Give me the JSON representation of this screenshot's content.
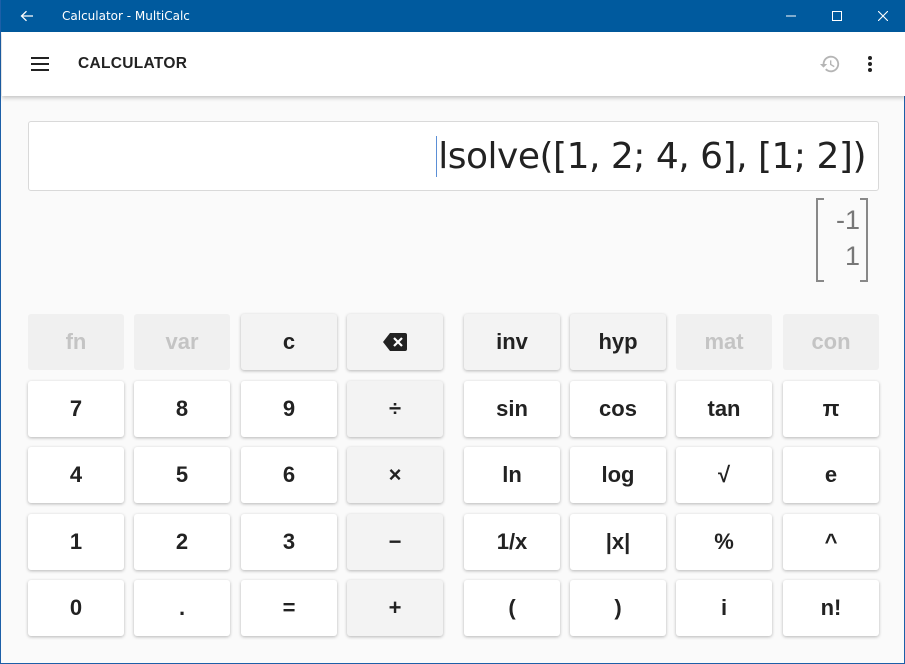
{
  "window": {
    "title": "Calculator - MultiCalc",
    "back_icon": "arrow-left-icon",
    "controls": [
      "minimize-icon",
      "maximize-icon",
      "close-icon"
    ],
    "titlebar_color": "#005a9e"
  },
  "appbar": {
    "menu_icon": "hamburger-menu-icon",
    "title": "CALCULATOR",
    "history_icon": "history-icon",
    "more_icon": "more-vertical-icon"
  },
  "expression": "lsolve([1, 2; 4, 6], [1; 2])",
  "result": {
    "values": [
      "-1",
      "1"
    ]
  },
  "keys": {
    "fn": "fn",
    "var": "var",
    "clear": "c",
    "backspace": "backspace-icon",
    "inv": "inv",
    "hyp": "hyp",
    "mat": "mat",
    "con": "con",
    "seven": "7",
    "eight": "8",
    "nine": "9",
    "divide": "÷",
    "sin": "sin",
    "cos": "cos",
    "tan": "tan",
    "pi": "π",
    "four": "4",
    "five": "5",
    "six": "6",
    "multiply": "×",
    "ln": "ln",
    "log": "log",
    "sqrt": "√",
    "e": "e",
    "one": "1",
    "two": "2",
    "three": "3",
    "minus": "−",
    "reciprocal": "1/x",
    "abs": "|x|",
    "percent": "%",
    "power": "^",
    "zero": "0",
    "dot": ".",
    "equals": "=",
    "plus": "+",
    "lparen": "(",
    "rparen": ")",
    "imag": "i",
    "factorial": "n!"
  }
}
